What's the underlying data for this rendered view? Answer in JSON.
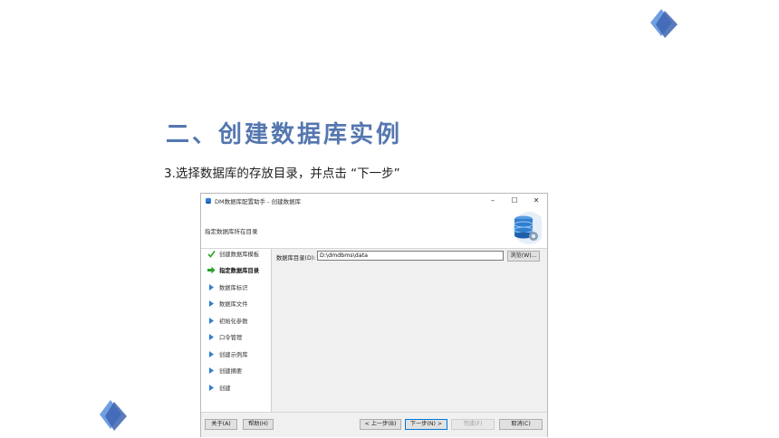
{
  "slide": {
    "title": "二、创建数据库实例",
    "subtitle": "3.选择数据库的存放目录，并点击 “下一步”"
  },
  "window": {
    "title": "DM数据库配置助手 - 创建数据库",
    "controls": {
      "minimize": "–",
      "maximize": "☐",
      "close": "✕"
    },
    "header_label": "指定数据库所在目录",
    "steps": [
      {
        "label": "创建数据库模板",
        "state": "done"
      },
      {
        "label": "指定数据库目录",
        "state": "current"
      },
      {
        "label": "数据库标识",
        "state": "pending"
      },
      {
        "label": "数据库文件",
        "state": "pending"
      },
      {
        "label": "初始化参数",
        "state": "pending"
      },
      {
        "label": "口令管理",
        "state": "pending"
      },
      {
        "label": "创建示例库",
        "state": "pending"
      },
      {
        "label": "创建摘要",
        "state": "pending"
      },
      {
        "label": "创建",
        "state": "pending"
      }
    ],
    "path_label": "数据库目录(D):",
    "path_value": "D:\\dmdbms\\data",
    "browse_label": "浏览(W)...",
    "footer": {
      "about": "关于(A)",
      "help": "帮助(H)",
      "prev": "< 上一步(B)",
      "next": "下一步(N) >",
      "finish": "完成(F)",
      "cancel": "取消(C)"
    }
  },
  "colors": {
    "title": "#5577b0",
    "diamond_light": "#6f9fe0",
    "diamond_dark": "#3d63b0",
    "check": "#2aa12a",
    "arrow_current": "#2aa12a",
    "arrow_pending": "#2f7fd0"
  }
}
